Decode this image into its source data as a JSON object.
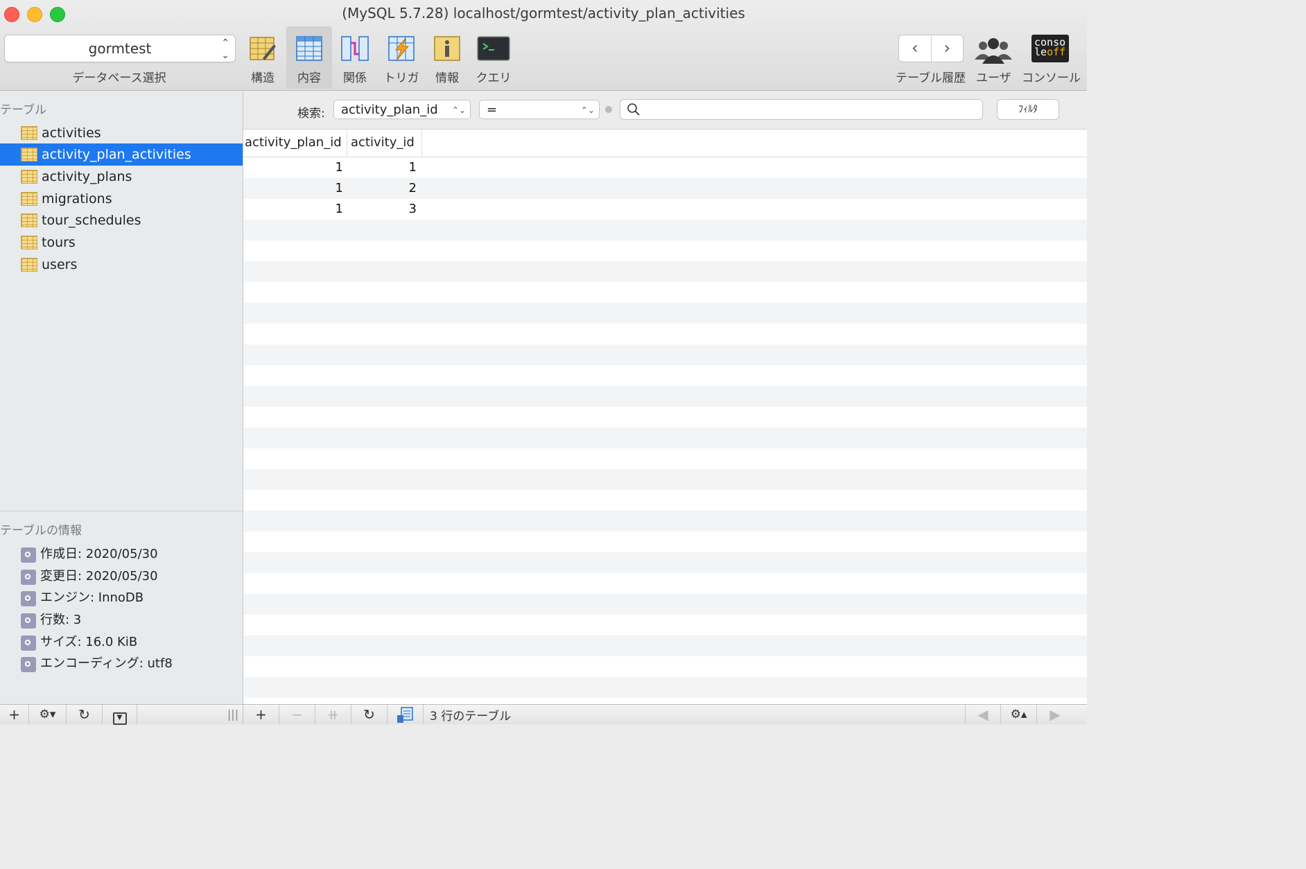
{
  "window": {
    "title": "(MySQL 5.7.28) localhost/gormtest/activity_plan_activities",
    "colors": {
      "close": "#fe5f57",
      "minimize": "#febc2e",
      "zoom": "#28c840",
      "selection": "#1e78f0"
    }
  },
  "toolbar": {
    "database": {
      "value": "gormtest",
      "caption": "データベース選択"
    },
    "buttons": [
      {
        "label": "構造",
        "icon": "structure-icon",
        "active": false
      },
      {
        "label": "内容",
        "icon": "content-icon",
        "active": true
      },
      {
        "label": "関係",
        "icon": "relations-icon",
        "active": false
      },
      {
        "label": "トリガ",
        "icon": "triggers-icon",
        "active": false
      },
      {
        "label": "情報",
        "icon": "info-icon",
        "active": false
      },
      {
        "label": "クエリ",
        "icon": "query-icon",
        "active": false
      }
    ],
    "history": {
      "back": "‹",
      "forward": "›",
      "caption": "テーブル履歴"
    },
    "users": {
      "caption": "ユーザ"
    },
    "console": {
      "caption": "コンソール",
      "badge_line1": "conso",
      "badge_line2": "le",
      "badge_line3": "off"
    }
  },
  "sidebar": {
    "tables_header": "テーブル",
    "tables": [
      {
        "name": "activities",
        "selected": false
      },
      {
        "name": "activity_plan_activities",
        "selected": true
      },
      {
        "name": "activity_plans",
        "selected": false
      },
      {
        "name": "migrations",
        "selected": false
      },
      {
        "name": "tour_schedules",
        "selected": false
      },
      {
        "name": "tours",
        "selected": false
      },
      {
        "name": "users",
        "selected": false
      }
    ],
    "info_header": "テーブルの情報",
    "info": [
      "作成日: 2020/05/30",
      "変更日: 2020/05/30",
      "エンジン: InnoDB",
      "行数: 3",
      "サイズ: 16.0 KiB",
      "エンコーディング: utf8"
    ]
  },
  "filter": {
    "label": "検索:",
    "field": "activity_plan_id",
    "operator": "=",
    "search_value": "",
    "button": "ﾌｨﾙﾀ"
  },
  "grid": {
    "columns": [
      "activity_plan_id",
      "activity_id"
    ],
    "rows": [
      [
        "1",
        "1"
      ],
      [
        "1",
        "2"
      ],
      [
        "1",
        "3"
      ]
    ]
  },
  "bottom": {
    "add": "+",
    "remove": "−",
    "duplicate": "⧺",
    "refresh": "↻",
    "status": "3 行のテーブル",
    "resize": "|||",
    "prev": "◀",
    "next": "▶"
  }
}
